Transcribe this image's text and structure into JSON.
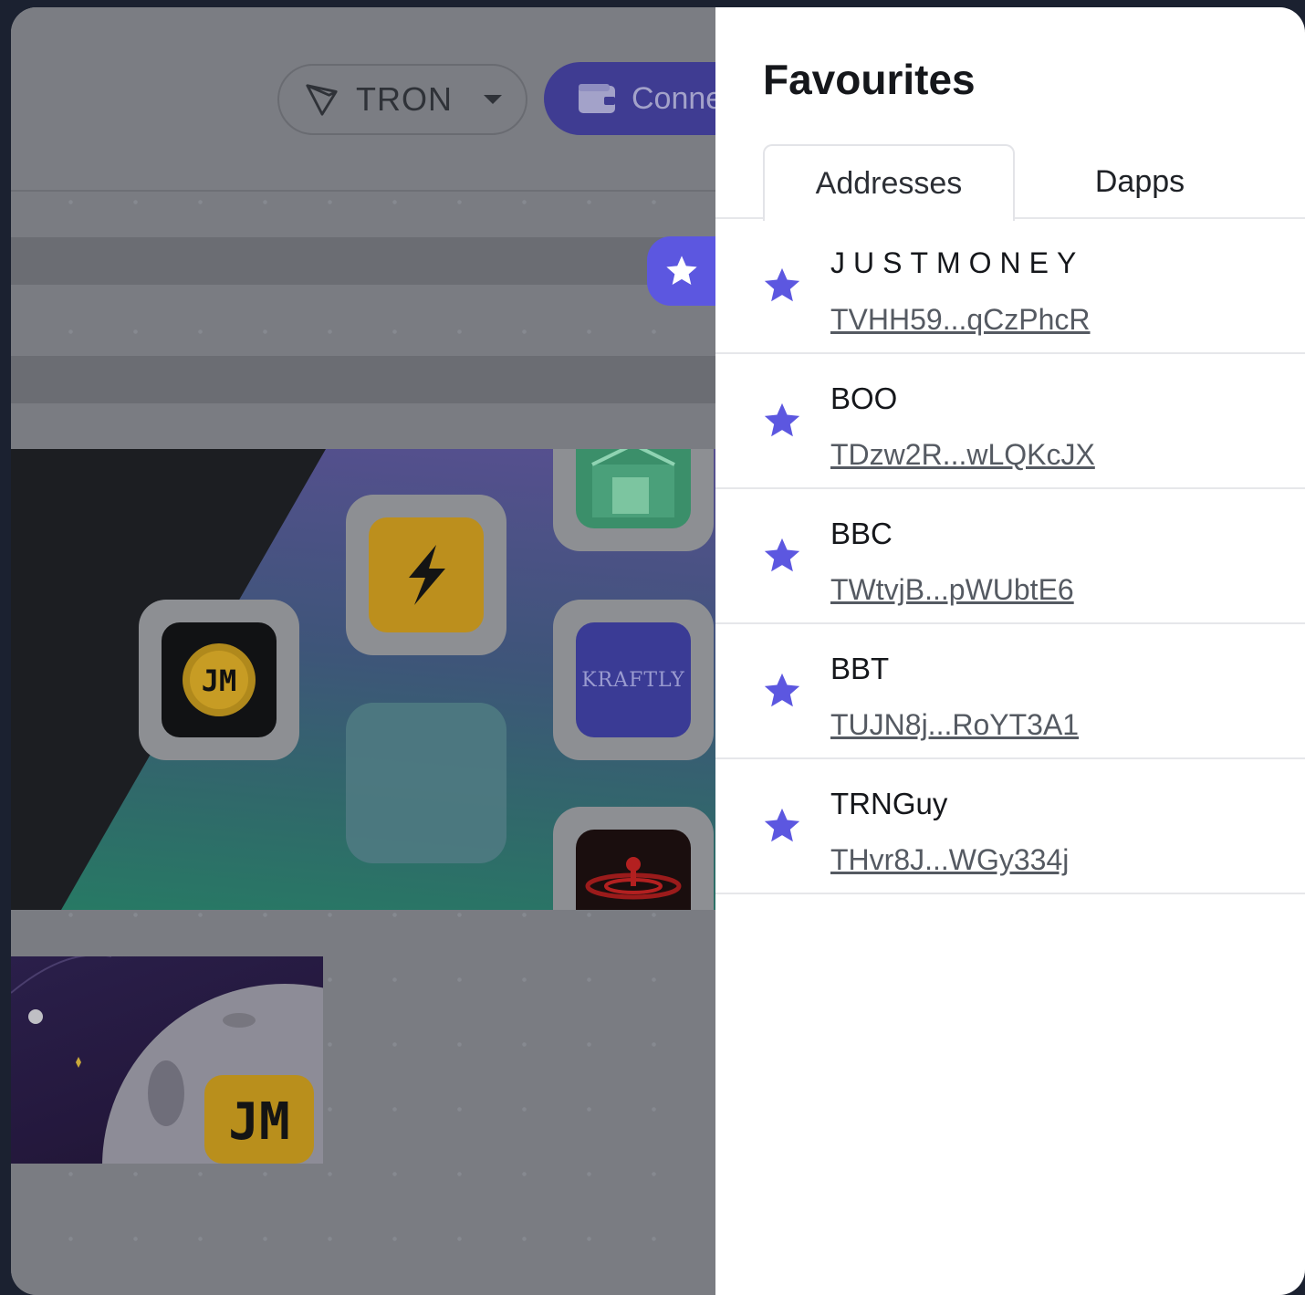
{
  "header": {
    "network": {
      "label": "TRON",
      "icon": "tron-icon"
    },
    "connect_button": {
      "label": "Connect"
    }
  },
  "favourites": {
    "title": "Favourites",
    "tabs": [
      {
        "label": "Addresses",
        "active": true
      },
      {
        "label": "Dapps",
        "active": false
      }
    ],
    "items": [
      {
        "name": "JUSTMONEY",
        "address": "TVHH59...qCzPhcR"
      },
      {
        "name": "BOO",
        "address": "TDzw2R...wLQKcJX"
      },
      {
        "name": "BBC",
        "address": "TWtvjB...pWUbtE6"
      },
      {
        "name": "BBT",
        "address": "TUJN8j...RoYT3A1"
      },
      {
        "name": "TRNGuy",
        "address": "THvr8J...WGy334j"
      }
    ]
  },
  "tiles": {
    "kraftly": "KRAFTLY",
    "jm": "JM"
  },
  "colors": {
    "accent": "#5c57e0",
    "panel_bg": "#ffffff",
    "text": "#15171b"
  }
}
